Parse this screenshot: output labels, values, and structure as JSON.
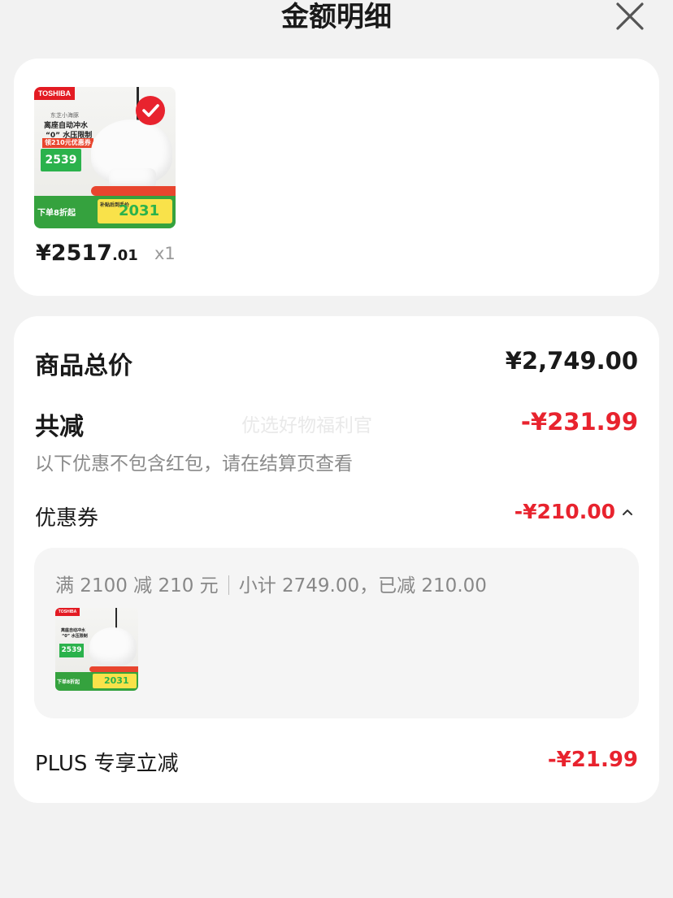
{
  "header": {
    "title": "金额明细",
    "close_icon": "close-icon"
  },
  "product": {
    "thumb_brand": "TOSHIBA",
    "thumb_line1": "东芝小海豚",
    "thumb_line2": "离座自动冲水",
    "thumb_line3": "“0” 水压限制",
    "thumb_coupon": "领210元优惠券",
    "thumb_price_left": "2539",
    "thumb_bottom_left": "下单8折起",
    "thumb_bottom_price": "2031",
    "thumb_bottom_note": "补贴后到手价",
    "price_main": "¥2517",
    "price_decimal": ".01",
    "quantity": "x1",
    "selected_icon": "check-circle-icon"
  },
  "detail": {
    "total_label": "商品总价",
    "total_value": "¥2,749.00",
    "reduce_label": "共减",
    "reduce_value": "-¥231.99",
    "reduce_note": "以下优惠不包含红包，请在结算页查看",
    "watermark": "优选好物福利官",
    "coupon_label": "优惠券",
    "coupon_value": "-¥210.00",
    "coupon_toggle_icon": "chevron-up-icon",
    "coupon_rule": "满 2100 减 210 元",
    "coupon_summary": "小计 2749.00，已减 210.00",
    "plus_label": "PLUS 专享立减",
    "plus_value": "-¥21.99"
  },
  "colors": {
    "accent_red": "#e8232e",
    "background": "#f2f2f2",
    "card": "#ffffff"
  }
}
